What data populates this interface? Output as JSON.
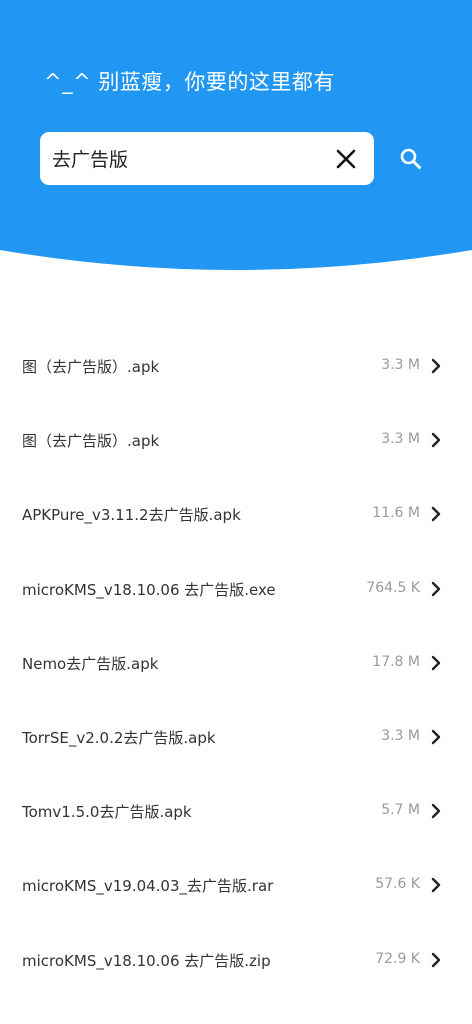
{
  "header": {
    "headline": "^_^ 别蓝瘦，你要的这里都有",
    "background_color": "#2196F3"
  },
  "search": {
    "value": "去广告版",
    "clear_icon": "close-icon",
    "submit_icon": "search-icon"
  },
  "results": [
    {
      "name": "图（去广告版）.apk",
      "size": "3.3 M"
    },
    {
      "name": "图（去广告版）.apk",
      "size": "3.3 M"
    },
    {
      "name": "APKPure_v3.11.2去广告版.apk",
      "size": "11.6 M"
    },
    {
      "name": "microKMS_v18.10.06 去广告版.exe",
      "size": "764.5 K"
    },
    {
      "name": "Nemo去广告版.apk",
      "size": "17.8 M"
    },
    {
      "name": "TorrSE_v2.0.2去广告版.apk",
      "size": "3.3 M"
    },
    {
      "name": "Tomv1.5.0去广告版.apk",
      "size": "5.7 M"
    },
    {
      "name": "microKMS_v19.04.03_去广告版.rar",
      "size": "57.6 K"
    },
    {
      "name": "microKMS_v18.10.06 去广告版.zip",
      "size": "72.9 K"
    }
  ]
}
